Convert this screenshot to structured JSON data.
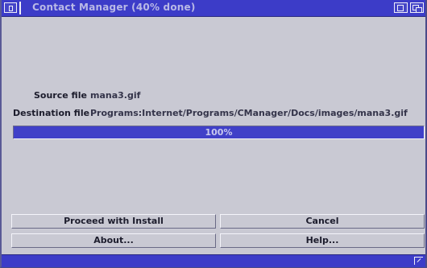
{
  "window": {
    "title": "Contact Manager (40% done)"
  },
  "fields": {
    "source_label": "Source file",
    "source_value": "mana3.gif",
    "destination_label": "Destination file",
    "destination_value": "Programs:Internet/Programs/CManager/Docs/images/mana3.gif"
  },
  "progress": {
    "text": "100%",
    "fraction": 1.0,
    "fill_color": "#4040c8"
  },
  "buttons": {
    "proceed": "Proceed with Install",
    "cancel": "Cancel",
    "about": "About...",
    "help": "Help..."
  },
  "icons": {
    "close": "close-gadget",
    "zoom": "zoom-gadget",
    "depth": "depth-gadget",
    "size": "size-gadget"
  },
  "colors": {
    "titlebar": "#3c3cc8",
    "background": "#c9c9d3"
  }
}
